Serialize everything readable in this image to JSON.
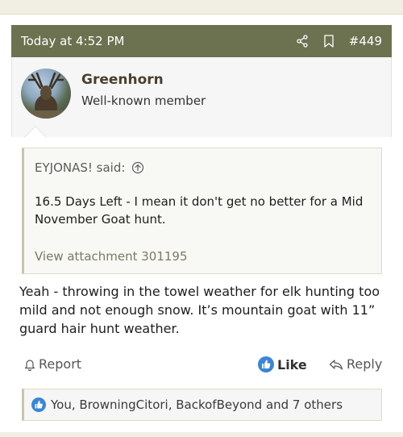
{
  "post": {
    "timestamp": "Today at 4:52 PM",
    "number": "#449",
    "header_icons": [
      "share-icon",
      "bookmark-icon"
    ]
  },
  "author": {
    "name": "Greenhorn",
    "title": "Well-known member"
  },
  "quote": {
    "attribution": "EYJONAS! said:",
    "text": "16.5 Days Left - I mean it don't get no better for a Mid November Goat hunt.",
    "attachment_link": "View attachment 301195"
  },
  "message": "Yeah - throwing in the towel weather for elk hunting too mild and not enough snow. It’s mountain goat with 11” guard hair hunt weather.",
  "actions": {
    "report": "Report",
    "like": "Like",
    "reply": "Reply"
  },
  "reactions": {
    "text": "You, BrowningCitori, BackofBeyond and 7 others"
  },
  "colors": {
    "header_bg": "#6c7250",
    "like_blue": "#3a86d4"
  }
}
